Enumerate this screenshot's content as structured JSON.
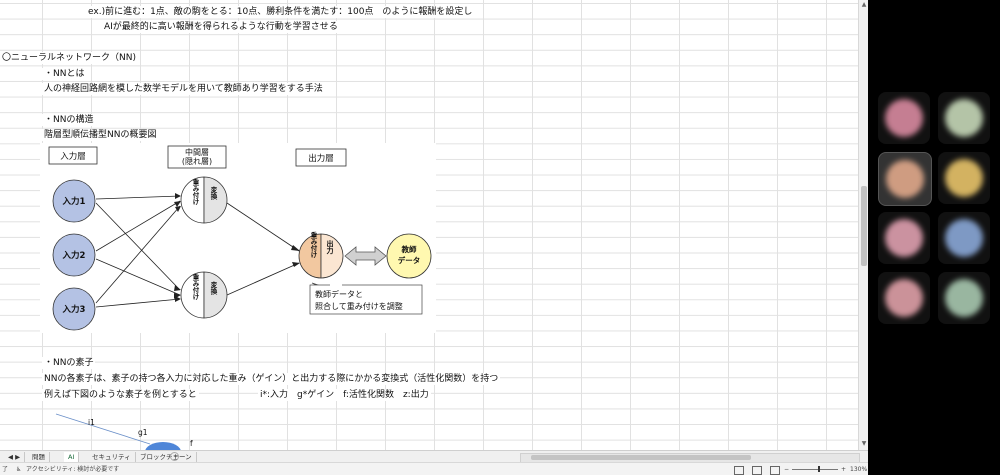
{
  "notes": {
    "line_reward_example": "ex.)前に進む：1点、敵の駒をとる：10点、勝利条件を満たす：100点　のように報酬を設定し",
    "line_reward_goal": "AIが最終的に高い報酬を得られるような行動を学習させる",
    "nn_heading": "〇ニューラルネットワーク（NN)",
    "nn_what_heading": "・NNとは",
    "nn_what_body": "人の神経回路網を模した数学モデルを用いて教師あり学習をする手法",
    "nn_structure_heading": "・NNの構造",
    "nn_structure_sub": "階層型順伝播型NNの概要図",
    "element_heading": "・NNの素子",
    "element_body": "NNの各素子は、素子の持つ各入力に対応した重み（ゲイン）と出力する際にかかる変換式（活性化関数）を持つ",
    "element_example": "例えば下図のような素子を例とすると",
    "element_legend": "i*:入力　g*ゲイン　f:活性化関数　z:出力"
  },
  "diagram": {
    "layer_input": "入力層",
    "layer_hidden_line1": "中間層",
    "layer_hidden_line2": "(隠れ層)",
    "layer_output": "出力層",
    "input1": "入力1",
    "input2": "入力2",
    "input3": "入力3",
    "weight_label": "重み付け",
    "transform_label": "変換",
    "output_weight_label": "重み付け",
    "output_label": "出力",
    "teacher_line1": "教師",
    "teacher_line2": "データ",
    "callout_line1": "教師データと",
    "callout_line2": "照合して重み付けを調整"
  },
  "mini_diagram": {
    "i1": "i1",
    "g1": "g1",
    "f": "f"
  },
  "sheet_tabs": [
    "問題",
    "AI",
    "セキュリティ",
    "ブロックチェーン"
  ],
  "active_tab": "AI",
  "status": {
    "ready": "了",
    "accessibility": "アクセシビリティ: 検討が必要です",
    "zoom": "130%"
  },
  "participants": [
    {
      "color": "#d98aa0",
      "speaking": false
    },
    {
      "color": "#c6d8b8",
      "speaking": false
    },
    {
      "color": "#e0a88a",
      "speaking": true
    },
    {
      "color": "#e8c46a",
      "speaking": false
    },
    {
      "color": "#e0a0b0",
      "speaking": false
    },
    {
      "color": "#8aa8d8",
      "speaking": false
    },
    {
      "color": "#e0a0a8",
      "speaking": false
    },
    {
      "color": "#a8c8b0",
      "speaking": false
    }
  ]
}
